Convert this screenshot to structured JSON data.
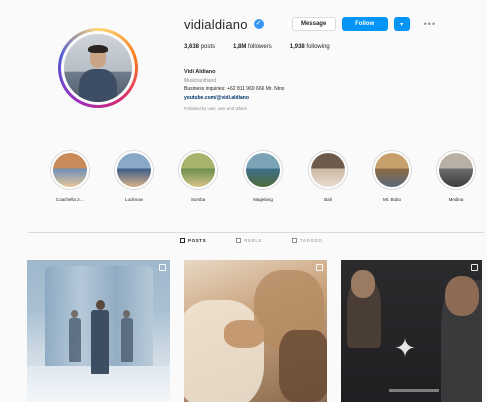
{
  "profile": {
    "username": "vidialdiano",
    "buttons": {
      "message": "Message",
      "follow": "Follow",
      "dropdown": "▾",
      "more": "•••"
    },
    "stats": [
      {
        "value": "3,638",
        "label": "posts"
      },
      {
        "value": "1,8M",
        "label": "followers"
      },
      {
        "value": "1,938",
        "label": "following"
      }
    ],
    "bio": {
      "name": "Vidi Aldiano",
      "category": "Musician/band",
      "line1": "Business inquiries: +62 811 969 666 Mr. Nino",
      "link": "youtube.com/@vidi.aldiano",
      "followed_by": "Followed by user, user and others"
    }
  },
  "highlights": [
    {
      "label": "Coachella 2…",
      "palette": [
        "#6f8fb8",
        "#c98b5a",
        "#e6c79a"
      ]
    },
    {
      "label": "Lucknow",
      "palette": [
        "#3b5a86",
        "#8aa9c8",
        "#d7b38b"
      ]
    },
    {
      "label": "Sumba",
      "palette": [
        "#6a8f4e",
        "#a6b56b",
        "#d8c48a"
      ]
    },
    {
      "label": "Magelang",
      "palette": [
        "#3d6f8a",
        "#7aa3b5",
        "#4f6b3a"
      ]
    },
    {
      "label": "Bali",
      "palette": [
        "#c9b7a3",
        "#6e5a4a",
        "#e9ddd0"
      ]
    },
    {
      "label": "Mt. Bobo",
      "palette": [
        "#8a6a45",
        "#c7a06b",
        "#5c6a7a"
      ]
    },
    {
      "label": "Medina",
      "palette": [
        "#6b6b6b",
        "#b8b0a4",
        "#3d3d3d"
      ]
    }
  ],
  "tabs": [
    {
      "label": "POSTS",
      "active": true
    },
    {
      "label": "REELS",
      "active": false
    },
    {
      "label": "TAGGED",
      "active": false
    }
  ],
  "colors": {
    "accent": "#0095f6",
    "link": "#00376b",
    "muted": "#8e8e8e"
  }
}
